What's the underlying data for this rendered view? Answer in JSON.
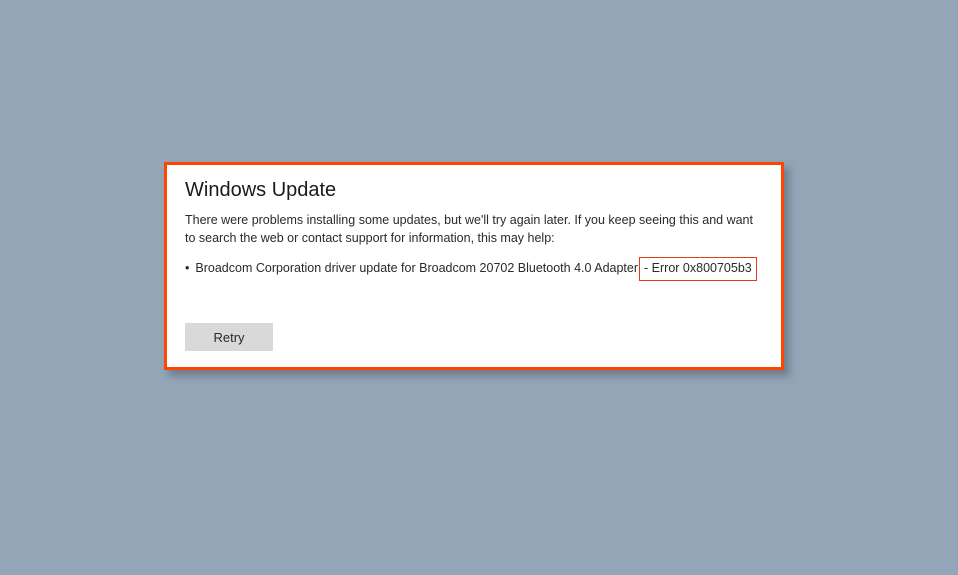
{
  "dialog": {
    "title": "Windows Update",
    "message": "There were problems installing some updates, but we'll try again later. If you keep seeing this and want to search the web or contact support for information, this may help:",
    "update_item": {
      "bullet": "•",
      "name": "Broadcom Corporation driver update for Broadcom 20702 Bluetooth 4.0 Adapter",
      "error_label": " - Error 0x800705b3"
    },
    "retry_label": "Retry"
  },
  "colors": {
    "background": "#94a5b7",
    "dialog_border": "#ff4500",
    "error_highlight_border": "#e63a1a",
    "button_bg": "#d9d9d9"
  }
}
